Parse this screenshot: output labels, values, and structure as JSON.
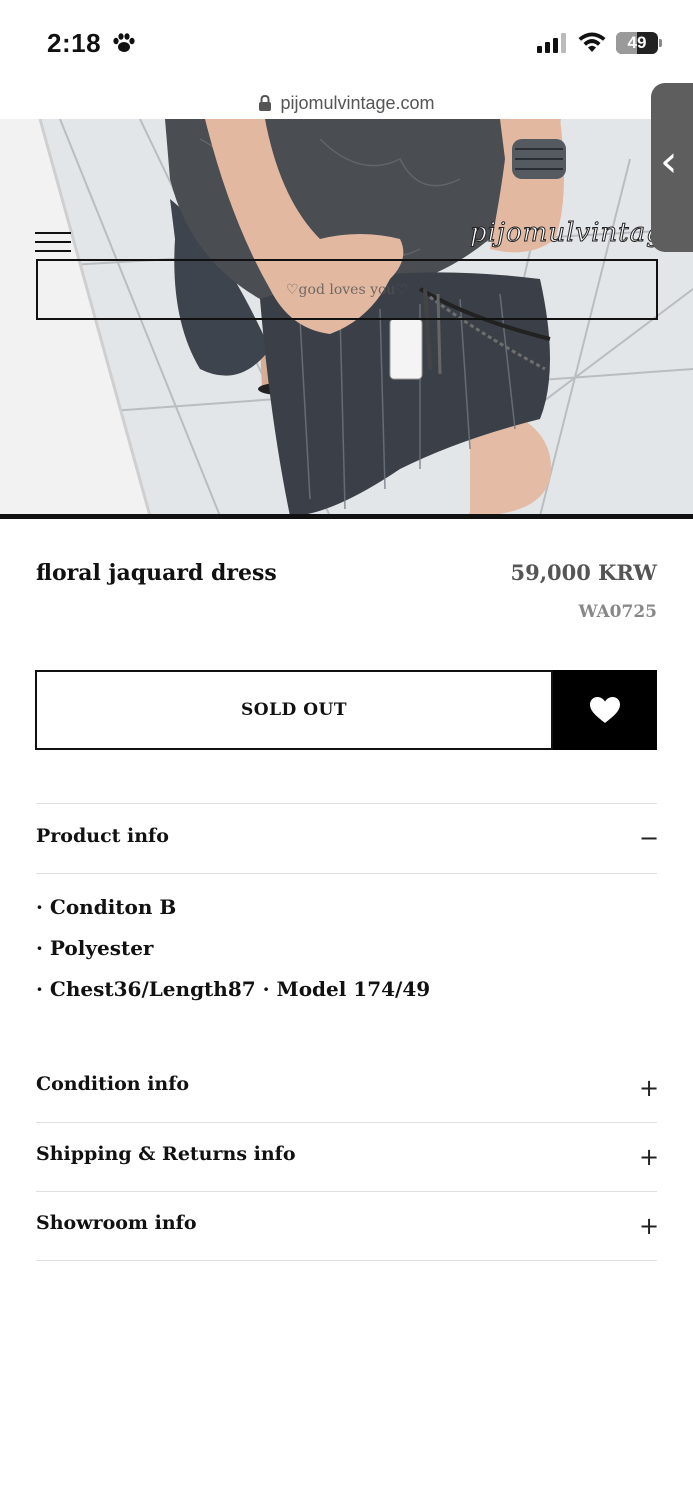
{
  "status_bar": {
    "time": "2:18",
    "battery": "49",
    "battery_level": 0.49
  },
  "browser": {
    "url": "pijomulvintage.com"
  },
  "header": {
    "banner_text": "♡god loves you♡",
    "brand": "pijomulvintage"
  },
  "product": {
    "title": "floral jaquard dress",
    "price": "59,000 KRW",
    "sku": "WA0725",
    "sold_out_label": "SOLD OUT"
  },
  "accordion": {
    "product_info": {
      "title": "Product info",
      "icon": "−",
      "lines": [
        "· Conditon B",
        "· Polyester",
        "· Chest36/Length87  · Model 174/49"
      ]
    },
    "condition_info": {
      "title": "Condition info",
      "icon": "+"
    },
    "shipping_info": {
      "title": "Shipping & Returns info",
      "icon": "+"
    },
    "showroom_info": {
      "title": "Showroom info",
      "icon": "+"
    }
  },
  "icons": {
    "status": [
      "paw-icon",
      "cellular-signal-icon",
      "wifi-icon",
      "battery-icon"
    ],
    "page": [
      "lock-icon",
      "menu-icon",
      "heart-icon",
      "chevron-left-icon"
    ]
  },
  "colors": {
    "accent": "#000000",
    "price": "#555555",
    "sku": "#888888",
    "rule": "#e0e0e0"
  }
}
